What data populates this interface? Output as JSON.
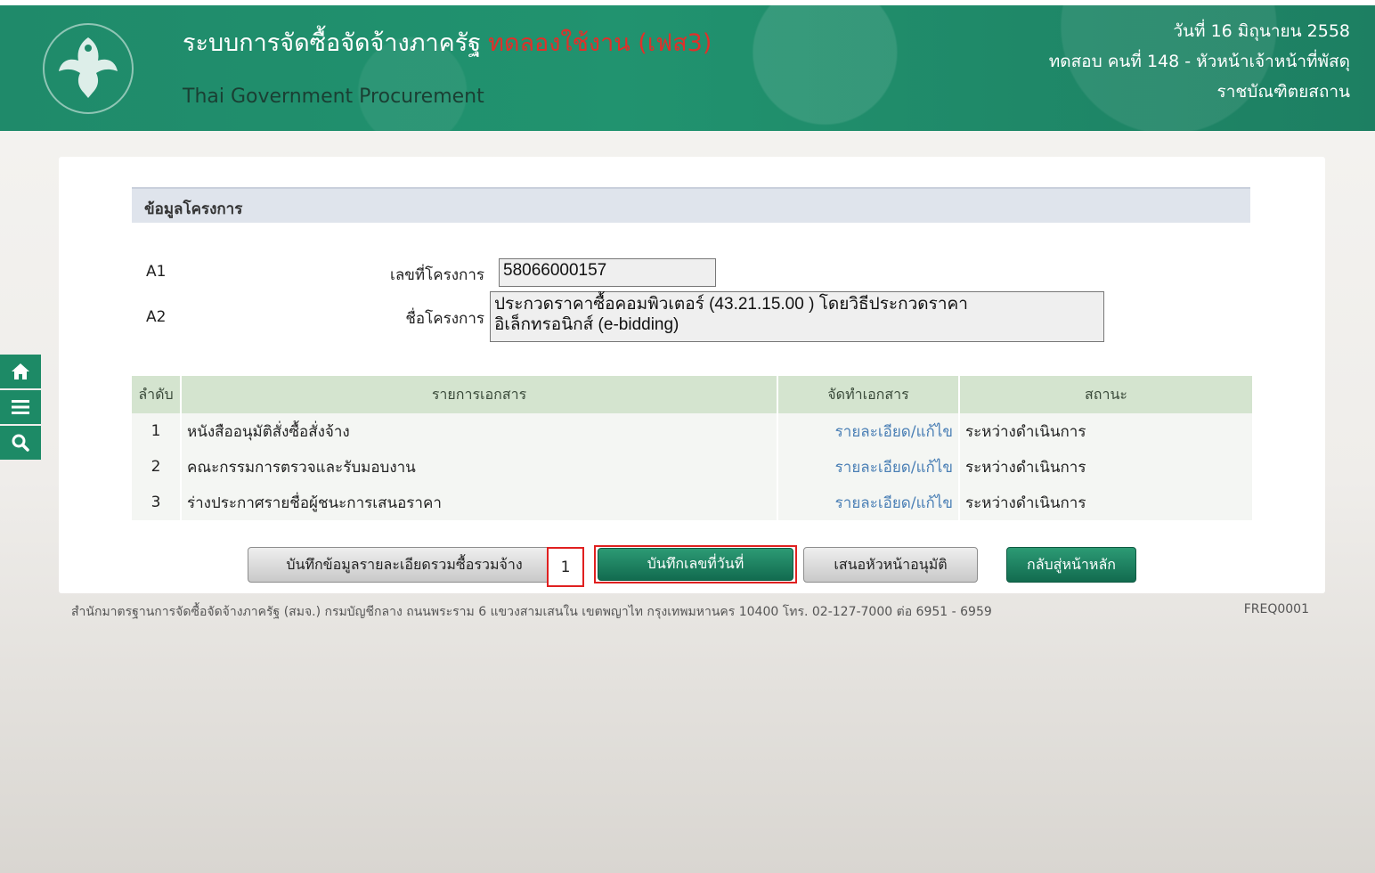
{
  "header": {
    "system_title": "ระบบการจัดซื้อจัดจ้างภาครัฐ",
    "trial_badge": "ทดลองใช้งาน (เฟส3)",
    "subtitle": "Thai Government Procurement",
    "date": "วันที่ 16 มิถุนายน 2558",
    "user": "ทดสอบ คนที่ 148 - หัวหน้าเจ้าหน้าที่พัสดุ",
    "org": "ราชบัณฑิตยสถาน"
  },
  "side_nav": [
    "home-icon",
    "menu-icon",
    "search-icon"
  ],
  "section": {
    "title": "ข้อมูลโครงการ"
  },
  "project": {
    "row1_code": "A1",
    "row1_label": "เลขที่โครงการ",
    "row1_value": "58066000157",
    "row2_code": "A2",
    "row2_label": "ชื่อโครงการ",
    "row2_value_line1": "ประกวดราคาซื้อคอมพิวเตอร์ (43.21.15.00 ) โดยวิธีประกวดราคา",
    "row2_value_line2": "อิเล็กทรอนิกส์ (e-bidding)"
  },
  "table": {
    "headers": [
      "ลำดับ",
      "รายการเอกสาร",
      "จัดทำเอกสาร",
      "สถานะ"
    ],
    "rows": [
      {
        "no": "1",
        "doc": "หนังสืออนุมัติสั่งซื้อสั่งจ้าง",
        "action": "รายละเอียด/แก้ไข",
        "status": "ระหว่างดำเนินการ"
      },
      {
        "no": "2",
        "doc": "คณะกรรมการตรวจและรับมอบงาน",
        "action": "รายละเอียด/แก้ไข",
        "status": "ระหว่างดำเนินการ"
      },
      {
        "no": "3",
        "doc": "ร่างประกาศรายชื่อผู้ชนะการเสนอราคา",
        "action": "รายละเอียด/แก้ไข",
        "status": "ระหว่างดำเนินการ"
      }
    ]
  },
  "buttons": {
    "save_details": "บันทึกข้อมูลรายละเอียดรวมซื้อรวมจ้าง",
    "save_number_date": "บันทึกเลขที่วันที่",
    "propose_approval": "เสนอหัวหน้าอนุมัติ",
    "back_home": "กลับสู่หน้าหลัก"
  },
  "annotation_marker": "1",
  "footer": {
    "address": "สำนักมาตรฐานการจัดซื้อจัดจ้างภาครัฐ (สมจ.) กรมบัญชีกลาง ถนนพระราม 6 แขวงสามเสนใน เขตพญาไท กรุงเทพมหานคร 10400 โทร. 02-127-7000 ต่อ 6951 - 6959",
    "page_code": "FREQ0001"
  },
  "colors": {
    "header_green": "#1f8a6a",
    "trial_red": "#e0302a",
    "link_blue": "#4a7fb5",
    "highlight_red": "#e02020"
  }
}
